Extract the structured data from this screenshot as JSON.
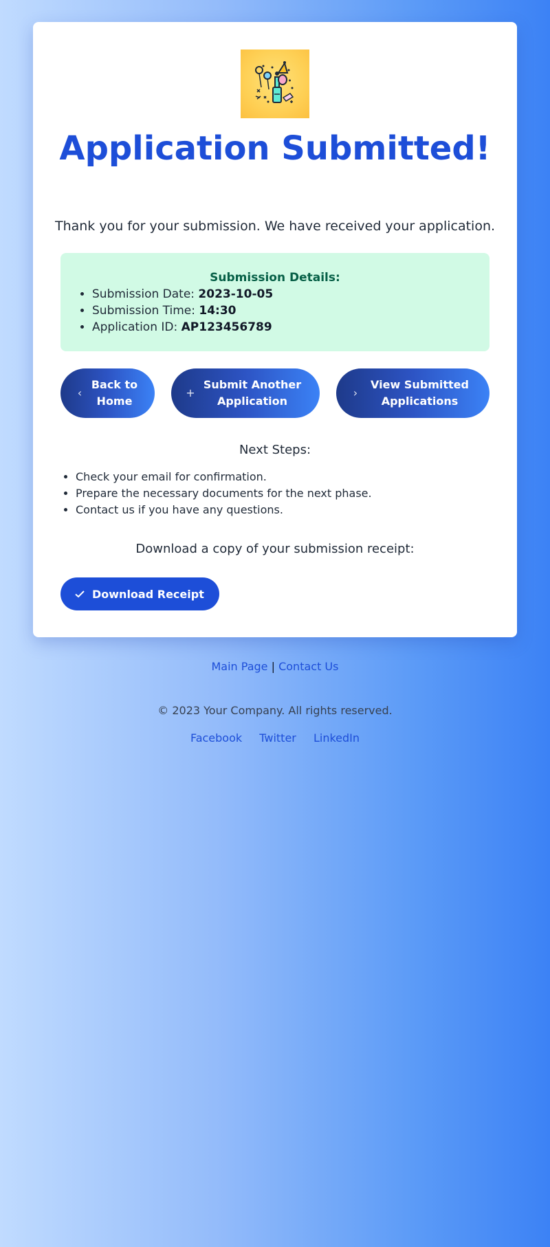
{
  "main": {
    "title": "Application Submitted!",
    "thanks": "Thank you for your submission. We have received your application.",
    "hero_icon": "celebration-icon"
  },
  "details": {
    "heading": "Submission Details:",
    "items": [
      {
        "label": "Submission Date: ",
        "value": "2023-10-05"
      },
      {
        "label": "Submission Time: ",
        "value": "14:30"
      },
      {
        "label": "Application ID: ",
        "value": "AP123456789"
      }
    ]
  },
  "actions": {
    "home": {
      "label": "Back to Home",
      "icon": "chevron-left-icon"
    },
    "another": {
      "label": "Submit Another Application",
      "icon": "plus-icon"
    },
    "view": {
      "label": "View Submitted Applications",
      "icon": "chevron-right-icon"
    }
  },
  "next_steps": {
    "title": "Next Steps:",
    "items": [
      "Check your email for confirmation.",
      "Prepare the necessary documents for the next phase.",
      "Contact us if you have any questions."
    ]
  },
  "download": {
    "text": "Download a copy of your submission receipt:",
    "button_label": "Download Receipt",
    "icon": "check-icon"
  },
  "footer": {
    "main_page": "Main Page",
    "separator": "|",
    "contact": "Contact Us",
    "copyright": "© 2023 Your Company. All rights reserved.",
    "social": [
      "Facebook",
      "Twitter",
      "LinkedIn"
    ]
  },
  "colors": {
    "accent": "#1d4ed8",
    "success_bg": "#d1fae5",
    "success_text": "#065f46",
    "hero_bg": "#fed055"
  }
}
